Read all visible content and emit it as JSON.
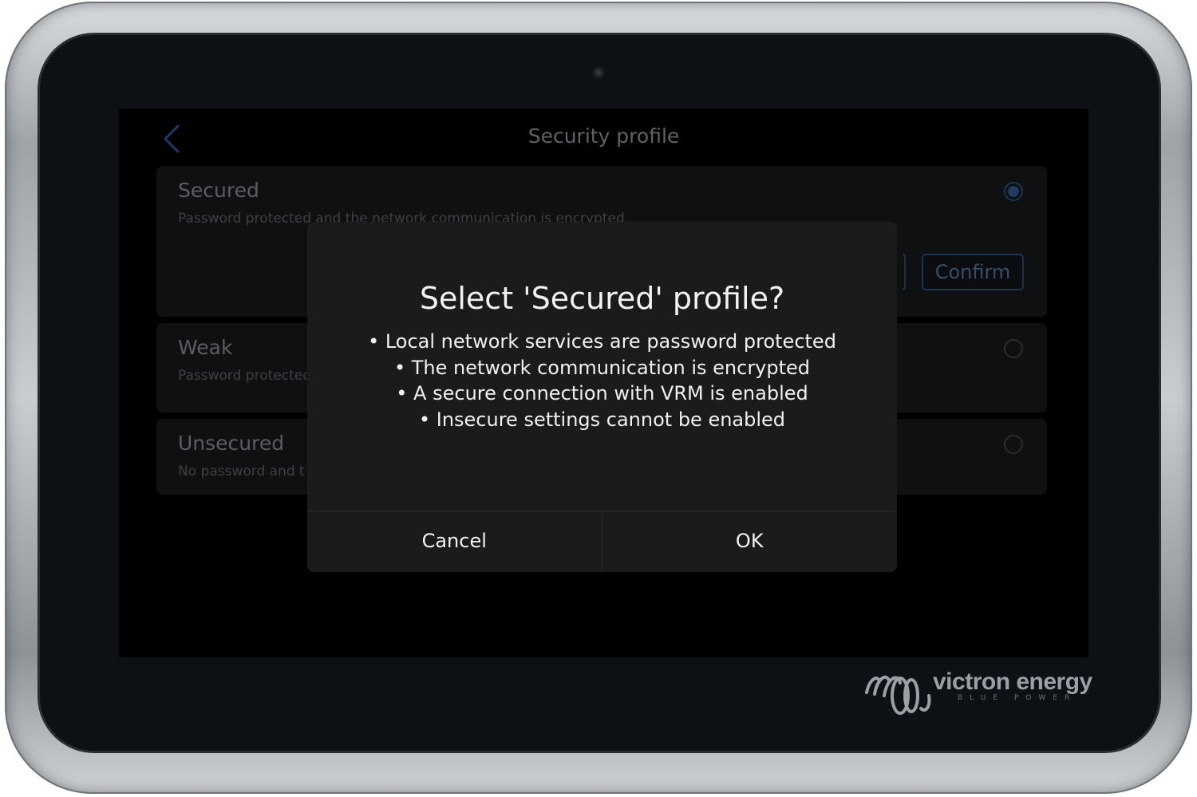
{
  "header": {
    "title": "Security profile",
    "back_icon": "chevron-left-icon"
  },
  "profiles": [
    {
      "title": "Secured",
      "subtitle": "Password protected and the network communication is encrypted",
      "selected": true
    },
    {
      "title": "Weak",
      "subtitle": "Password protected",
      "selected": false
    },
    {
      "title": "Unsecured",
      "subtitle": "No password and t",
      "selected": false
    }
  ],
  "secured_panel": {
    "confirm_label": "Confirm"
  },
  "dialog": {
    "title": "Select 'Secured' profile?",
    "lines": [
      "• Local network services are password protected",
      "• The network communication is encrypted",
      "• A secure connection with VRM is enabled",
      "• Insecure settings cannot be enabled"
    ],
    "cancel_label": "Cancel",
    "ok_label": "OK"
  },
  "brand": {
    "name": "victron energy",
    "tagline": "BLUE POWER"
  },
  "colors": {
    "accent": "#1e3a63",
    "dialog_bg": "#1b1b1b",
    "screen_bg": "#000000"
  }
}
